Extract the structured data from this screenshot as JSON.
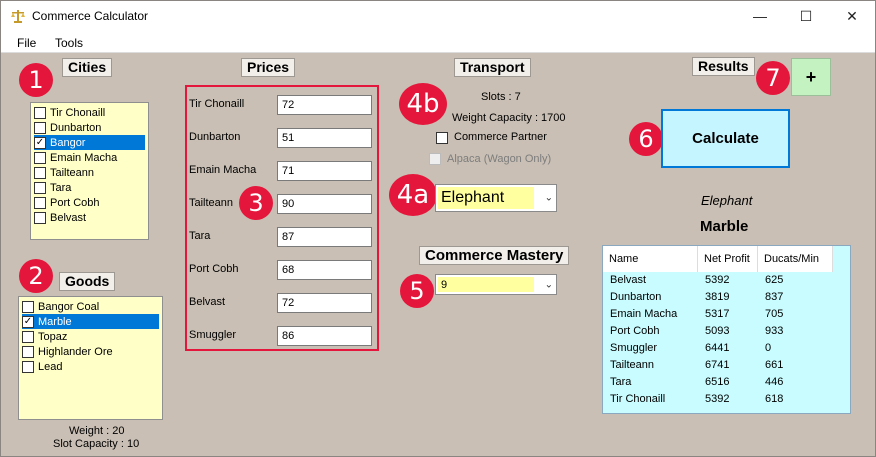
{
  "window": {
    "title": "Commerce Calculator",
    "min_glyph": "—",
    "max_glyph": "☐",
    "close_glyph": "✕"
  },
  "menu": {
    "file": "File",
    "tools": "Tools"
  },
  "cities": {
    "label": "Cities",
    "items": [
      {
        "name": "Tir Chonaill",
        "checked": false,
        "selected": false
      },
      {
        "name": "Dunbarton",
        "checked": false,
        "selected": false
      },
      {
        "name": "Bangor",
        "checked": true,
        "selected": true
      },
      {
        "name": "Emain Macha",
        "checked": false,
        "selected": false
      },
      {
        "name": "Tailteann",
        "checked": false,
        "selected": false
      },
      {
        "name": "Tara",
        "checked": false,
        "selected": false
      },
      {
        "name": "Port Cobh",
        "checked": false,
        "selected": false
      },
      {
        "name": "Belvast",
        "checked": false,
        "selected": false
      }
    ]
  },
  "goods": {
    "label": "Goods",
    "items": [
      {
        "name": "Bangor Coal",
        "checked": false,
        "selected": false
      },
      {
        "name": "Marble",
        "checked": true,
        "selected": true
      },
      {
        "name": "Topaz",
        "checked": false,
        "selected": false
      },
      {
        "name": "Highlander Ore",
        "checked": false,
        "selected": false
      },
      {
        "name": "Lead",
        "checked": false,
        "selected": false
      }
    ],
    "weight": "Weight : 20",
    "slot_capacity": "Slot Capacity : 10"
  },
  "prices": {
    "label": "Prices",
    "rows": [
      {
        "city": "Tir Chonaill",
        "value": "72"
      },
      {
        "city": "Dunbarton",
        "value": "51"
      },
      {
        "city": "Emain Macha",
        "value": "71"
      },
      {
        "city": "Tailteann",
        "value": "90"
      },
      {
        "city": "Tara",
        "value": "87"
      },
      {
        "city": "Port Cobh",
        "value": "68"
      },
      {
        "city": "Belvast",
        "value": "72"
      },
      {
        "city": "Smuggler",
        "value": "86"
      }
    ]
  },
  "transport": {
    "label": "Transport",
    "slots": "Slots : 7",
    "weight_capacity": "Weight Capacity : 1700",
    "commerce_partner": "Commerce Partner",
    "alpaca": "Alpaca (Wagon Only)",
    "selected": "Elephant"
  },
  "mastery": {
    "label": "Commerce Mastery",
    "selected": "9"
  },
  "results": {
    "label": "Results",
    "add_label": "+",
    "calculate_label": "Calculate",
    "transport_name": "Elephant",
    "good_name": "Marble",
    "columns": [
      "Name",
      "Net Profit",
      "Ducats/Min"
    ],
    "rows": [
      [
        "Belvast",
        "5392",
        "625"
      ],
      [
        "Dunbarton",
        "3819",
        "837"
      ],
      [
        "Emain Macha",
        "5317",
        "705"
      ],
      [
        "Port Cobh",
        "5093",
        "933"
      ],
      [
        "Smuggler",
        "6441",
        "0"
      ],
      [
        "Tailteann",
        "6741",
        "661"
      ],
      [
        "Tara",
        "6516",
        "446"
      ],
      [
        "Tir Chonaill",
        "5392",
        "618"
      ]
    ]
  },
  "badges": {
    "b1": "1",
    "b2": "2",
    "b3": "3",
    "b4a": "4a",
    "b4b": "4b",
    "b5": "5",
    "b6": "6",
    "b7": "7"
  },
  "colors": {
    "accent_red": "#e5163b",
    "selection_blue": "#0078d7",
    "list_yellow": "#ffffc8",
    "table_cyan": "#c8fcff"
  }
}
